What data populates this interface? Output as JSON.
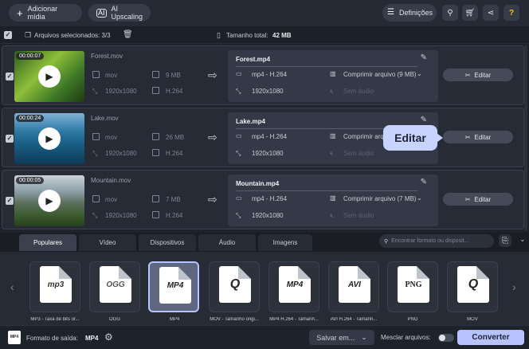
{
  "topbar": {
    "add_media": "Adicionar mídia",
    "ai_upscaling": "AI Upscaling",
    "settings": "Definições"
  },
  "selection": {
    "selected_label": "Arquivos selecionados: 3/3",
    "total_size_label": "Tamanho total:",
    "total_size_value": "42 MB"
  },
  "files": [
    {
      "duration": "00:00:07",
      "name": "Forest.mov",
      "container": "mov",
      "size": "9 MB",
      "resolution": "1920x1080",
      "codec": "H.264",
      "out_name": "Forest.mp4",
      "out_format": "mp4 - H.264",
      "compress": "Comprimir arquivo (9 MB)",
      "out_res": "1920x1080",
      "audio": "Sem áudio",
      "edit": "Editar"
    },
    {
      "duration": "00:00:24",
      "name": "Lake.mov",
      "container": "mov",
      "size": "26 MB",
      "resolution": "1920x1080",
      "codec": "H.264",
      "out_name": "Lake.mp4",
      "out_format": "mp4 - H.264",
      "compress": "Comprimir arquivo",
      "out_res": "1920x1080",
      "audio": "Sem áudio",
      "edit": "Editar"
    },
    {
      "duration": "00:00:05",
      "name": "Mountain.mov",
      "container": "mov",
      "size": "7 MB",
      "resolution": "1920x1080",
      "codec": "H.264",
      "out_name": "Mountain.mp4",
      "out_format": "mp4 - H.264",
      "compress": "Comprimir arquivo (7 MB)",
      "out_res": "1920x1080",
      "audio": "Sem áudio",
      "edit": "Editar"
    }
  ],
  "tooltip": "Editar",
  "tabs": [
    "Populares",
    "Vídeo",
    "Dispositivos",
    "Áudio",
    "Imagens"
  ],
  "search_placeholder": "Encontrar formato ou disposit...",
  "formats": [
    {
      "logo": "mp3",
      "label": "MP3 - Taxa de bits or..."
    },
    {
      "logo": "OGG",
      "label": "OGG"
    },
    {
      "logo": "MP4",
      "label": "MP4"
    },
    {
      "logo": "Q",
      "label": "MOV - Tamanho origi..."
    },
    {
      "logo": "MP4",
      "label": "MP4 H.264 - Tamanh..."
    },
    {
      "logo": "AVI",
      "label": "AVI H.264 - Tamanh..."
    },
    {
      "logo": "PNG",
      "label": "PNG"
    },
    {
      "logo": "Q",
      "label": "MOV"
    }
  ],
  "bottom": {
    "output_label": "Formato de saída:",
    "output_value": "MP4",
    "save_to": "Salvar em...",
    "merge": "Mesclar arquivos:",
    "convert": "Converter"
  },
  "colors": {
    "accent": "#b6c3ff",
    "tooltip": "#c8d3ff",
    "help": "#f5c518"
  }
}
